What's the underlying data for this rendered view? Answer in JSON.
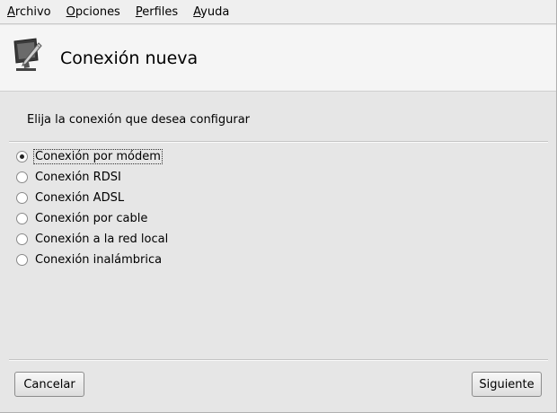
{
  "menubar": {
    "items": [
      {
        "first": "A",
        "rest": "rchivo"
      },
      {
        "first": "O",
        "rest": "pciones"
      },
      {
        "first": "P",
        "rest": "erfiles"
      },
      {
        "first": "A",
        "rest": "yuda"
      }
    ]
  },
  "banner": {
    "title": "Conexión nueva",
    "icon": "network-config-icon"
  },
  "prompt": "Elija la conexión que desea configurar",
  "options": [
    {
      "label": "Conexión por módem",
      "checked": true
    },
    {
      "label": "Conexión RDSI",
      "checked": false
    },
    {
      "label": "Conexión ADSL",
      "checked": false
    },
    {
      "label": "Conexión por cable",
      "checked": false
    },
    {
      "label": "Conexión a la red local",
      "checked": false
    },
    {
      "label": "Conexión inalámbrica",
      "checked": false
    }
  ],
  "buttons": {
    "cancel": "Cancelar",
    "next": "Siguiente"
  }
}
